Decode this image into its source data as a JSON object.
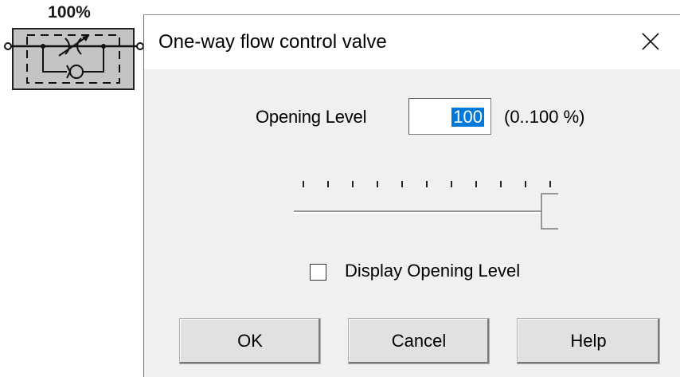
{
  "valve": {
    "opening_display": "100%",
    "icon": "one-way-flow-control-valve-symbol"
  },
  "dialog": {
    "title": "One-way flow control valve",
    "close_icon": "close-icon",
    "opening_level_label": "Opening Level",
    "opening_level_value": "100",
    "opening_level_range": "(0..100 %)",
    "slider_fraction": 1.0,
    "slider_tick_count": 11,
    "display_opening_level_label": "Display Opening Level",
    "display_opening_level_checked": false,
    "buttons": {
      "ok": "OK",
      "cancel": "Cancel",
      "help": "Help"
    }
  },
  "colors": {
    "selection": "#0078d7",
    "dialog_bg": "#f0f0f0",
    "symbol_fill": "#c4c4c4"
  }
}
